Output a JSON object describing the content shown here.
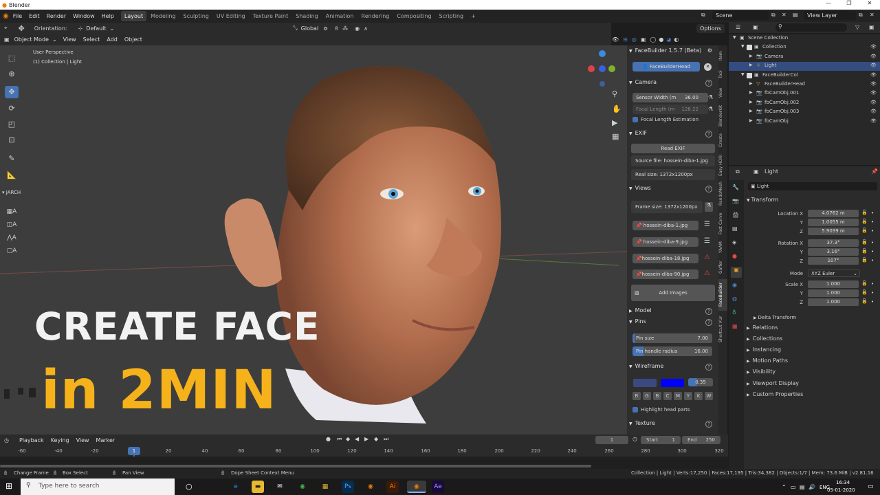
{
  "window": {
    "title": "Blender"
  },
  "menubar": {
    "items": [
      "File",
      "Edit",
      "Render",
      "Window",
      "Help"
    ]
  },
  "workspaces": [
    "Layout",
    "Modeling",
    "Sculpting",
    "UV Editing",
    "Texture Paint",
    "Shading",
    "Animation",
    "Rendering",
    "Compositing",
    "Scripting"
  ],
  "scene": {
    "scene_name": "Scene",
    "view_layer": "View Layer"
  },
  "header": {
    "orientation_label": "Orientation:",
    "orientation_value": "Default",
    "transform_orientation": "Global",
    "options": "Options",
    "mode": "Object Mode",
    "view": "View",
    "select": "Select",
    "add": "Add",
    "object": "Object"
  },
  "viewport": {
    "perspective": "User Perspective",
    "collection": "(1) Collection | Light",
    "addon_label": "JARCH",
    "overlay_line1": "CREATE FACE",
    "overlay_line2": "in 2MIN"
  },
  "npanel": {
    "addon_title": "FaceBuilder 1.5.7 (Beta)",
    "head_button": "FaceBuilderHead",
    "camera": {
      "title": "Camera",
      "sensor_width_label": "Sensor Width (m",
      "sensor_width_value": "36.00",
      "focal_length_label": "Focal Length (m",
      "focal_length_value": "128.22",
      "focal_estimation": "Focal Length Estimation"
    },
    "exif": {
      "title": "EXIF",
      "read_button": "Read EXIF",
      "source_file": "Source file: hossein-diba-1.jpg",
      "real_size": "Real size: 1372x1200px"
    },
    "views": {
      "title": "Views",
      "frame_size": "Frame size: 1372x1200px",
      "images": [
        "hossein-diba-1.jpg",
        "hossein-diba-9.jpg",
        "hossein-diba-18.jpg",
        "hossein-diba-90.jpg"
      ],
      "add_images": "Add Images"
    },
    "model": {
      "title": "Model"
    },
    "pins": {
      "title": "Pins",
      "pin_size_label": "Pin size",
      "pin_size_value": "7.00",
      "pin_radius_label": "Pin handle radius",
      "pin_radius_value": "16.00"
    },
    "wireframe": {
      "title": "Wireframe",
      "opacity": "0.35",
      "color_buttons": [
        "R",
        "G",
        "B",
        "C",
        "M",
        "Y",
        "K",
        "W"
      ],
      "highlight": "Highlight head parts"
    },
    "texture": {
      "title": "Texture"
    }
  },
  "side_tabs": [
    "Item",
    "Tool",
    "View",
    "BlenderKit",
    "Create",
    "Easy HDRI",
    "RandoMesh",
    "Fast Carve",
    "YAAM",
    "Gaffer",
    "FaceBuilder",
    "Shortcut VUr"
  ],
  "outliner": {
    "search_placeholder": "",
    "items": [
      {
        "label": "Scene Collection",
        "indent": 0
      },
      {
        "label": "Collection",
        "indent": 1
      },
      {
        "label": "Camera",
        "indent": 2
      },
      {
        "label": "Light",
        "indent": 2
      },
      {
        "label": "FaceBuilderCol",
        "indent": 1
      },
      {
        "label": "FaceBuilderHead",
        "indent": 2
      },
      {
        "label": "fbCamObj.001",
        "indent": 2
      },
      {
        "label": "fbCamObj.002",
        "indent": 2
      },
      {
        "label": "fbCamObj.003",
        "indent": 2
      },
      {
        "label": "fbCamObj",
        "indent": 2
      }
    ]
  },
  "properties": {
    "header_name": "Light",
    "object_name": "Light",
    "transform_title": "Transform",
    "location_label": "Location X",
    "location": [
      "4.0762 m",
      "1.0055 m",
      "5.9039 m"
    ],
    "rotation_label": "Rotation X",
    "rotation": [
      "37.3°",
      "3.16°",
      "107°"
    ],
    "mode_label": "Mode",
    "mode_value": "XYZ Euler",
    "scale_label": "Scale X",
    "scale": [
      "1.000",
      "1.000",
      "1.000"
    ],
    "y_label": "Y",
    "z_label": "Z",
    "delta_transform": "Delta Transform",
    "sections": [
      "Relations",
      "Collections",
      "Instancing",
      "Motion Paths",
      "Visibility",
      "Viewport Display",
      "Custom Properties"
    ]
  },
  "timeline": {
    "playback": "Playback",
    "keying": "Keying",
    "view": "View",
    "marker": "Marker",
    "current_frame": "1",
    "start_label": "Start",
    "start_value": "1",
    "end_label": "End",
    "end_value": "250",
    "ticks": [
      "-60",
      "-40",
      "-20",
      "20",
      "40",
      "60",
      "80",
      "100",
      "120",
      "140",
      "160",
      "180",
      "200",
      "220",
      "240",
      "260",
      "280",
      "300",
      "320"
    ],
    "frame_marker": "1"
  },
  "statusbar": {
    "change_frame": "Change Frame",
    "box_select": "Box Select",
    "pan_view": "Pan View",
    "context_menu": "Dope Sheet Context Menu",
    "stats": "Collection | Light | Verts:17,250 | Faces:17,195 | Tris:34,382 | Objects:1/7 | Mem: 73.6 MiB | v2.81.16"
  },
  "taskbar": {
    "search_placeholder": "Type here to search",
    "language": "ENG",
    "time": "16:34",
    "date": "05-01-2020"
  },
  "colors": {
    "accent": "#4772b3",
    "overlay_yellow": "#f5b21a",
    "wire_color": "#0000ff",
    "warning": "#d04040"
  }
}
